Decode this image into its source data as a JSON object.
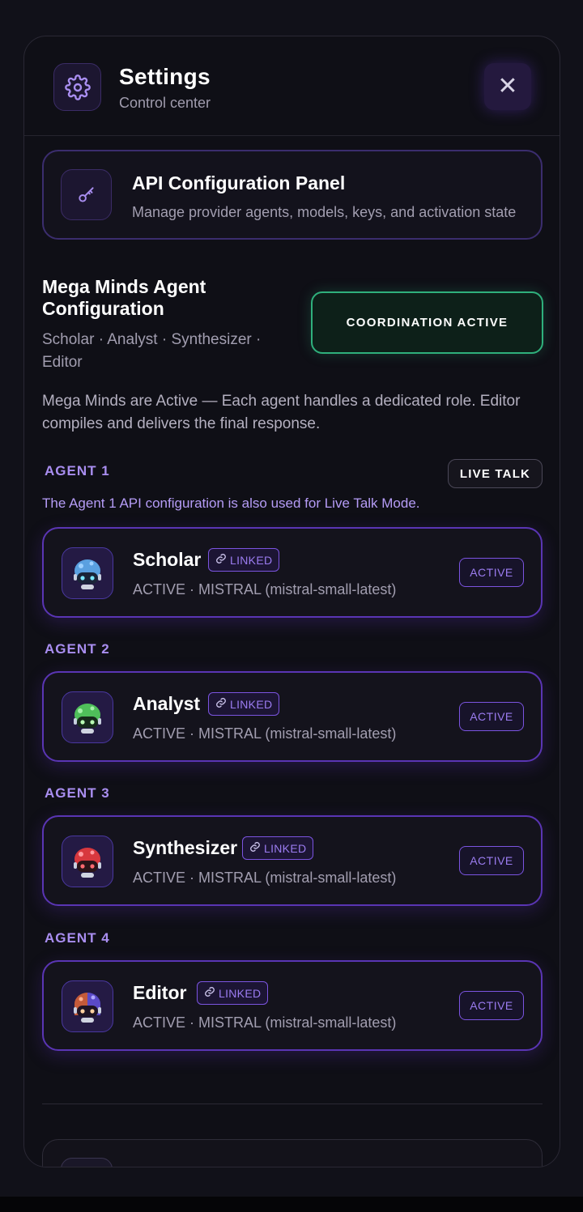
{
  "header": {
    "title": "Settings",
    "subtitle": "Control center",
    "icon": "gear-icon",
    "close_icon": "close-icon"
  },
  "api_panel": {
    "title": "API Configuration Panel",
    "subtitle": "Manage provider agents, models, keys, and activation state",
    "icon": "key-icon"
  },
  "mega_minds": {
    "title": "Mega Minds Agent Configuration",
    "roles": "Scholar · Analyst · Synthesizer · Editor",
    "status_button": "COORDINATION ACTIVE",
    "description": "Mega Minds are Active — Each agent handles a dedicated role. Editor compiles and delivers the final response."
  },
  "live_talk": {
    "label": "LIVE TALK",
    "note": "The Agent 1 API configuration is also used for Live Talk Mode."
  },
  "agents": [
    {
      "label": "AGENT 1",
      "name": "Scholar",
      "linked": "LINKED",
      "status": "ACTIVE · MISTRAL (mistral-small-latest)",
      "button": "ACTIVE",
      "color": "#5aa0e0"
    },
    {
      "label": "AGENT 2",
      "name": "Analyst",
      "linked": "LINKED",
      "status": "ACTIVE · MISTRAL (mistral-small-latest)",
      "button": "ACTIVE",
      "color": "#4fbf5a"
    },
    {
      "label": "AGENT 3",
      "name": "Synthesizer",
      "linked": "LINKED",
      "status": "ACTIVE · MISTRAL (mistral-small-latest)",
      "button": "ACTIVE",
      "color": "#d8383e"
    },
    {
      "label": "AGENT 4",
      "name": "Editor",
      "linked": "LINKED",
      "status": "ACTIVE · MISTRAL (mistral-small-latest)",
      "button": "ACTIVE",
      "color": "#c45a3a"
    }
  ],
  "colors": {
    "accent": "#7b54e0",
    "success": "#2fb07c",
    "background": "#0f0f16"
  }
}
